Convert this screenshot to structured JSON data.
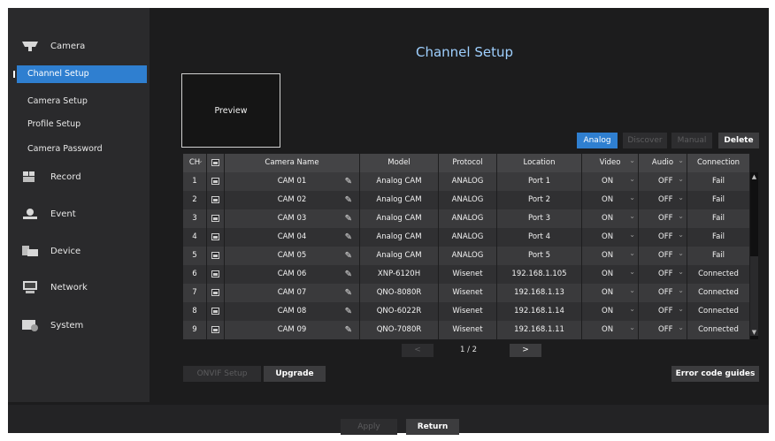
{
  "sidebar": {
    "camera_label": "Camera",
    "sub_items": [
      "Channel Setup",
      "Camera Setup",
      "Profile Setup",
      "Camera Password"
    ],
    "categories": [
      "Record",
      "Event",
      "Device",
      "Network",
      "System"
    ]
  },
  "main": {
    "title": "Channel Setup",
    "preview_label": "Preview",
    "buttons": {
      "analog": "Analog",
      "discover": "Discover",
      "manual": "Manual",
      "delete": "Delete",
      "onvif": "ONVIF Setup",
      "upgrade": "Upgrade",
      "error": "Error code guides",
      "prev": "<",
      "next": ">"
    },
    "page_indicator": "1 / 2"
  },
  "table": {
    "headers": {
      "ch": "CH",
      "name": "Camera Name",
      "model": "Model",
      "protocol": "Protocol",
      "location": "Location",
      "video": "Video",
      "audio": "Audio",
      "connection": "Connection"
    },
    "rows": [
      {
        "ch": "1",
        "name": "CAM 01",
        "model": "Analog CAM",
        "protocol": "ANALOG",
        "location": "Port 1",
        "video": "ON",
        "audio": "OFF",
        "connection": "Fail"
      },
      {
        "ch": "2",
        "name": "CAM 02",
        "model": "Analog CAM",
        "protocol": "ANALOG",
        "location": "Port 2",
        "video": "ON",
        "audio": "OFF",
        "connection": "Fail"
      },
      {
        "ch": "3",
        "name": "CAM 03",
        "model": "Analog CAM",
        "protocol": "ANALOG",
        "location": "Port 3",
        "video": "ON",
        "audio": "OFF",
        "connection": "Fail"
      },
      {
        "ch": "4",
        "name": "CAM 04",
        "model": "Analog CAM",
        "protocol": "ANALOG",
        "location": "Port 4",
        "video": "ON",
        "audio": "OFF",
        "connection": "Fail"
      },
      {
        "ch": "5",
        "name": "CAM 05",
        "model": "Analog CAM",
        "protocol": "ANALOG",
        "location": "Port 5",
        "video": "ON",
        "audio": "OFF",
        "connection": "Fail"
      },
      {
        "ch": "6",
        "name": "CAM 06",
        "model": "XNP-6120H",
        "protocol": "Wisenet",
        "location": "192.168.1.105",
        "video": "ON",
        "audio": "OFF",
        "connection": "Connected"
      },
      {
        "ch": "7",
        "name": "CAM 07",
        "model": "QNO-8080R",
        "protocol": "Wisenet",
        "location": "192.168.1.13",
        "video": "ON",
        "audio": "OFF",
        "connection": "Connected"
      },
      {
        "ch": "8",
        "name": "CAM 08",
        "model": "QNO-6022R",
        "protocol": "Wisenet",
        "location": "192.168.1.14",
        "video": "ON",
        "audio": "OFF",
        "connection": "Connected"
      },
      {
        "ch": "9",
        "name": "CAM 09",
        "model": "QNO-7080R",
        "protocol": "Wisenet",
        "location": "192.168.1.11",
        "video": "ON",
        "audio": "OFF",
        "connection": "Connected"
      }
    ]
  },
  "footer": {
    "apply": "Apply",
    "return": "Return"
  },
  "colors": {
    "accent": "#2f7fd0",
    "title": "#9fd0ff",
    "background": "#1c1c1d"
  },
  "icons": [
    "camera-icon",
    "record-icon",
    "event-icon",
    "device-icon",
    "network-icon",
    "system-icon",
    "image-icon",
    "pencil-icon"
  ]
}
